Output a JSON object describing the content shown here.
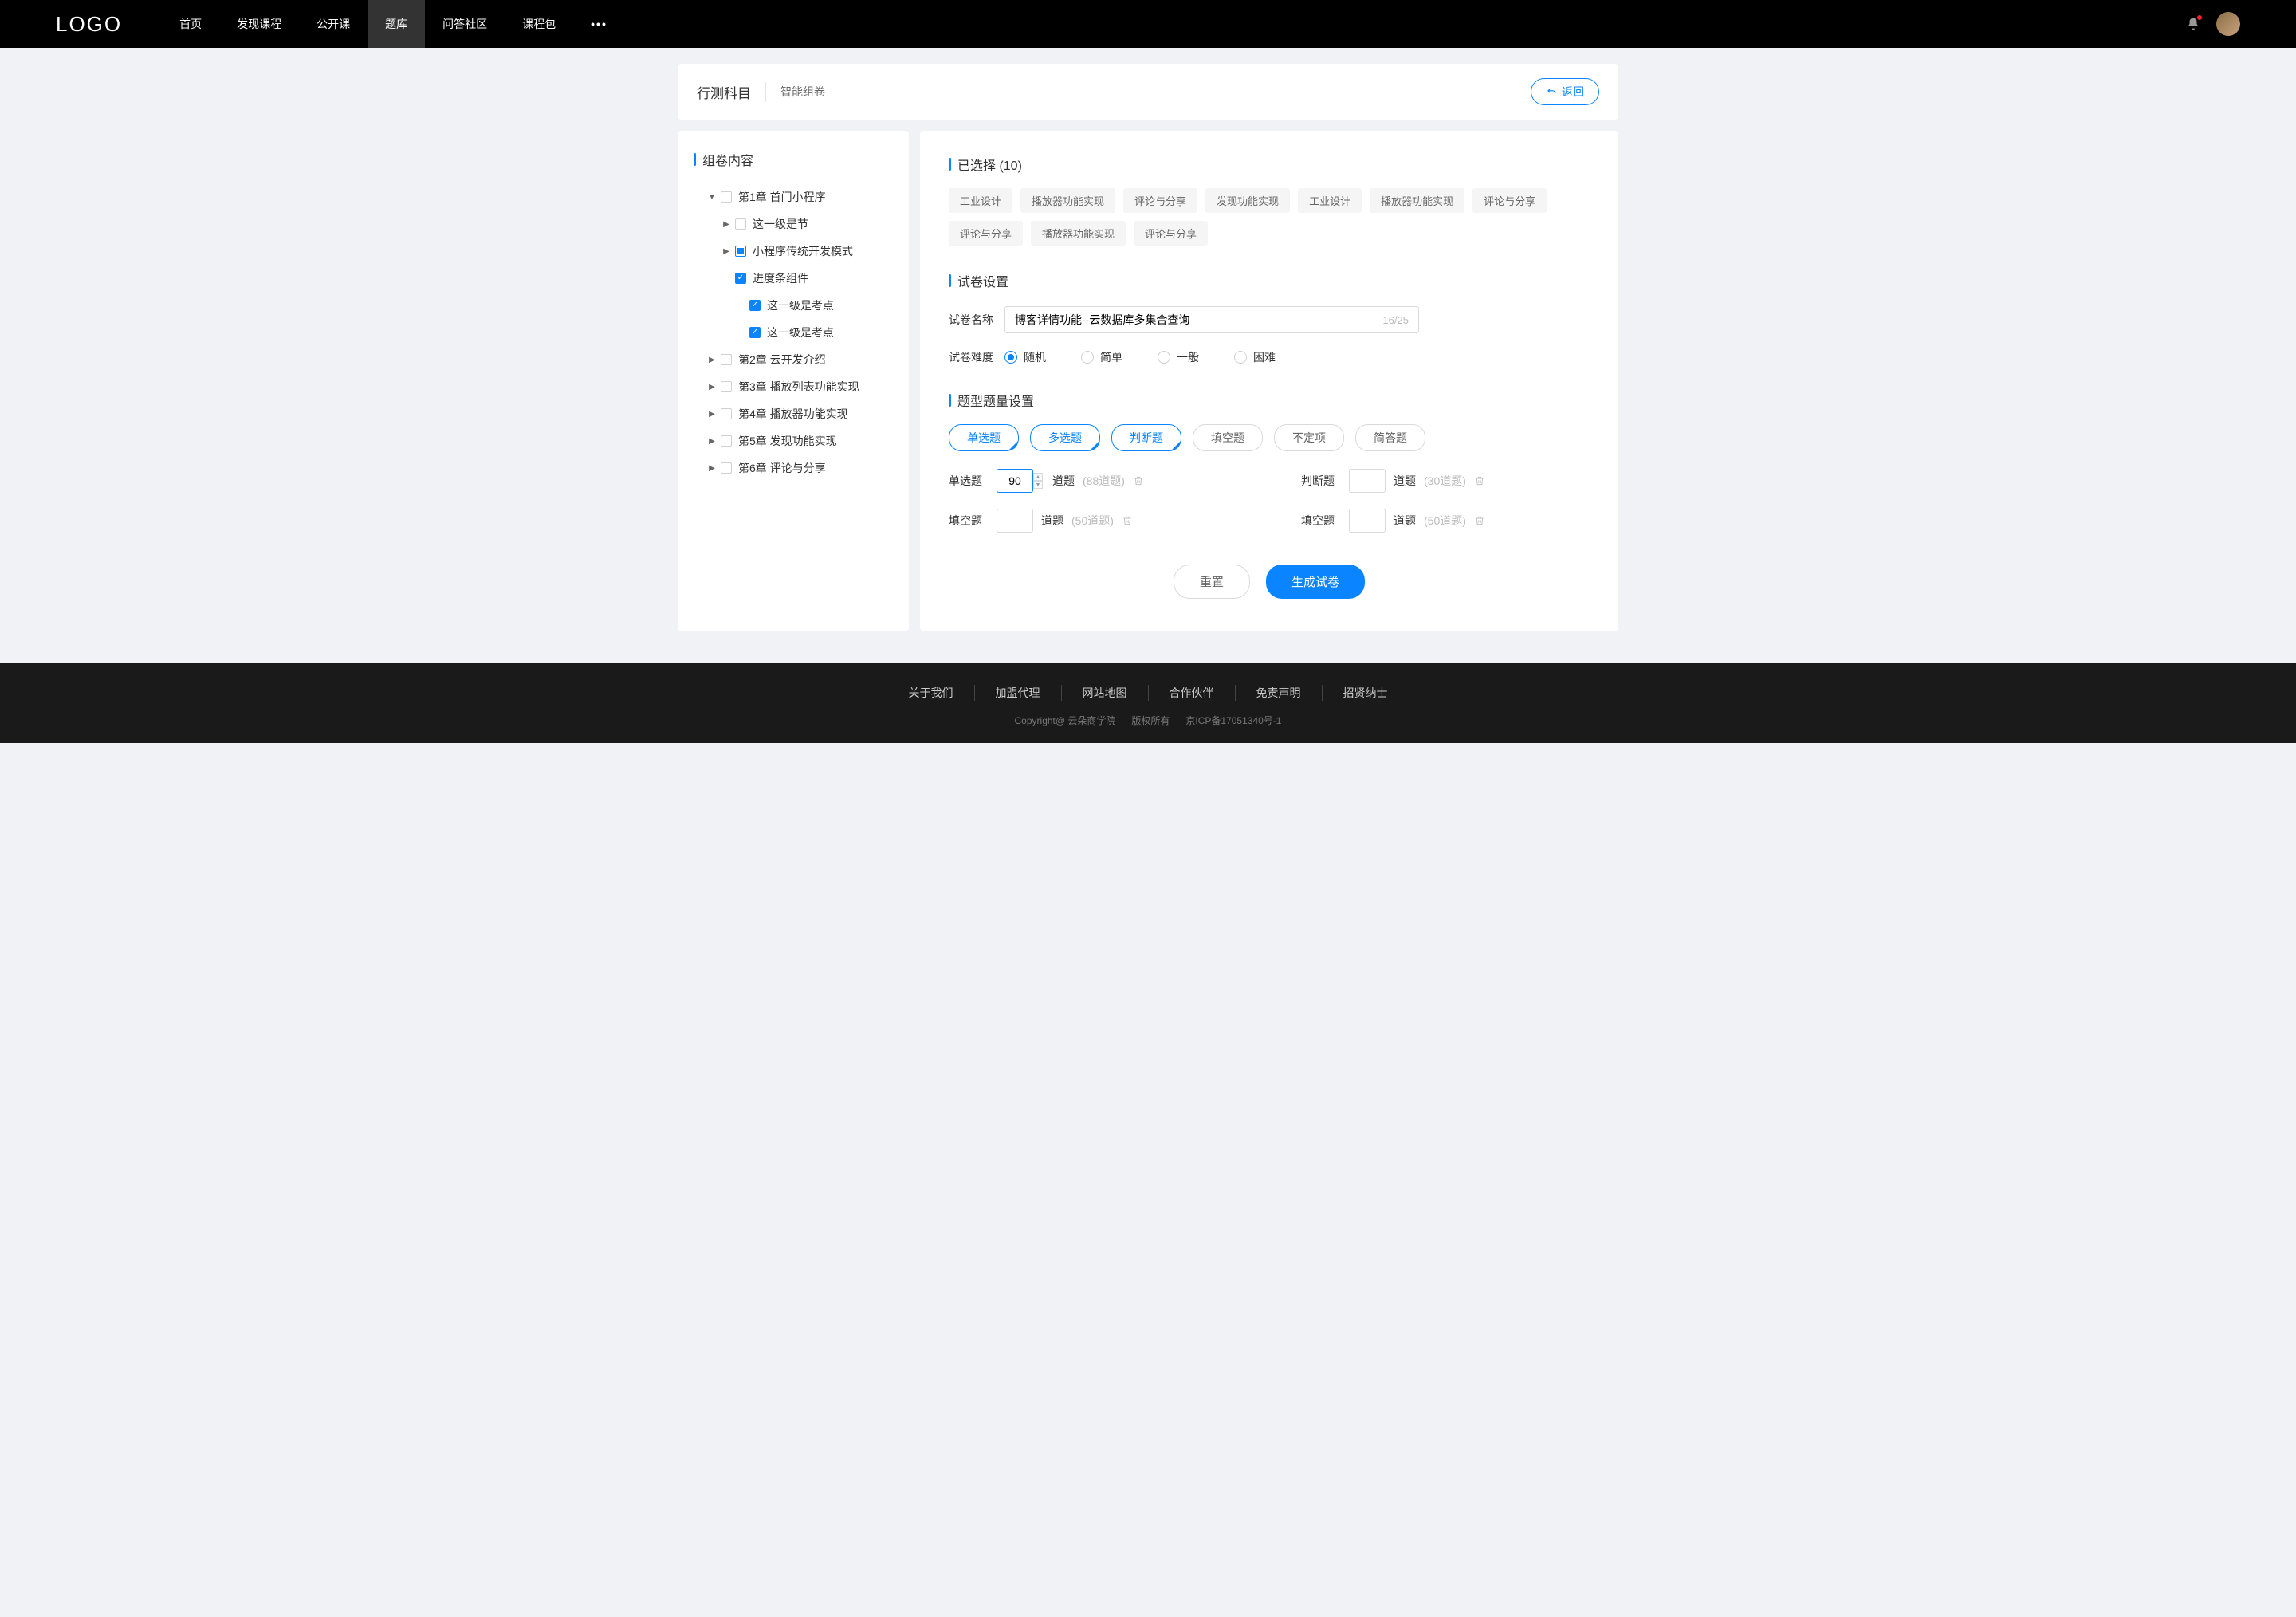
{
  "header": {
    "logo": "LOGO",
    "nav": [
      "首页",
      "发现课程",
      "公开课",
      "题库",
      "问答社区",
      "课程包"
    ],
    "nav_active": 3,
    "more": "•••"
  },
  "titleBar": {
    "main": "行测科目",
    "sub": "智能组卷",
    "back": "返回"
  },
  "sidebar": {
    "title": "组卷内容",
    "tree": [
      {
        "level": 0,
        "toggle": "▼",
        "check": "none",
        "label": "第1章 首门小程序"
      },
      {
        "level": 1,
        "toggle": "▶",
        "check": "none",
        "label": "这一级是节"
      },
      {
        "level": 1,
        "toggle": "▶",
        "check": "partial",
        "label": "小程序传统开发模式"
      },
      {
        "level": 1,
        "toggle": "",
        "check": "checked",
        "label": "进度条组件"
      },
      {
        "level": 2,
        "toggle": "",
        "check": "checked",
        "label": "这一级是考点"
      },
      {
        "level": 2,
        "toggle": "",
        "check": "checked",
        "label": "这一级是考点"
      },
      {
        "level": 0,
        "toggle": "▶",
        "check": "none",
        "label": "第2章 云开发介绍"
      },
      {
        "level": 0,
        "toggle": "▶",
        "check": "none",
        "label": "第3章 播放列表功能实现"
      },
      {
        "level": 0,
        "toggle": "▶",
        "check": "none",
        "label": "第4章 播放器功能实现"
      },
      {
        "level": 0,
        "toggle": "▶",
        "check": "none",
        "label": "第5章 发现功能实现"
      },
      {
        "level": 0,
        "toggle": "▶",
        "check": "none",
        "label": "第6章 评论与分享"
      }
    ]
  },
  "main": {
    "selected": {
      "title": "已选择 (10)",
      "tags": [
        "工业设计",
        "播放器功能实现",
        "评论与分享",
        "发现功能实现",
        "工业设计",
        "播放器功能实现",
        "评论与分享",
        "评论与分享",
        "播放器功能实现",
        "评论与分享"
      ]
    },
    "settings": {
      "title": "试卷设置",
      "nameLabel": "试卷名称",
      "nameValue": "博客详情功能--云数据库多集合查询",
      "nameCount": "16/25",
      "diffLabel": "试卷难度",
      "diffs": [
        {
          "label": "随机",
          "checked": true
        },
        {
          "label": "简单",
          "checked": false
        },
        {
          "label": "一般",
          "checked": false
        },
        {
          "label": "困难",
          "checked": false
        }
      ]
    },
    "qty": {
      "title": "题型题量设置",
      "types": [
        {
          "label": "单选题",
          "selected": true
        },
        {
          "label": "多选题",
          "selected": true
        },
        {
          "label": "判断题",
          "selected": true
        },
        {
          "label": "填空题",
          "selected": false
        },
        {
          "label": "不定项",
          "selected": false
        },
        {
          "label": "简答题",
          "selected": false
        }
      ],
      "unit": "道题",
      "rows": [
        {
          "label": "单选题",
          "value": "90",
          "hint": "(88道题)",
          "spinner": true
        },
        {
          "label": "判断题",
          "value": "",
          "hint": "(30道题)",
          "spinner": false
        },
        {
          "label": "填空题",
          "value": "",
          "hint": "(50道题)",
          "spinner": false
        },
        {
          "label": "填空题",
          "value": "",
          "hint": "(50道题)",
          "spinner": false
        }
      ]
    },
    "actions": {
      "reset": "重置",
      "submit": "生成试卷"
    }
  },
  "footer": {
    "links": [
      "关于我们",
      "加盟代理",
      "网站地图",
      "合作伙伴",
      "免责声明",
      "招贤纳士"
    ],
    "copy1": "Copyright@ 云朵商学院",
    "copy2": "版权所有",
    "copy3": "京ICP备17051340号-1"
  }
}
